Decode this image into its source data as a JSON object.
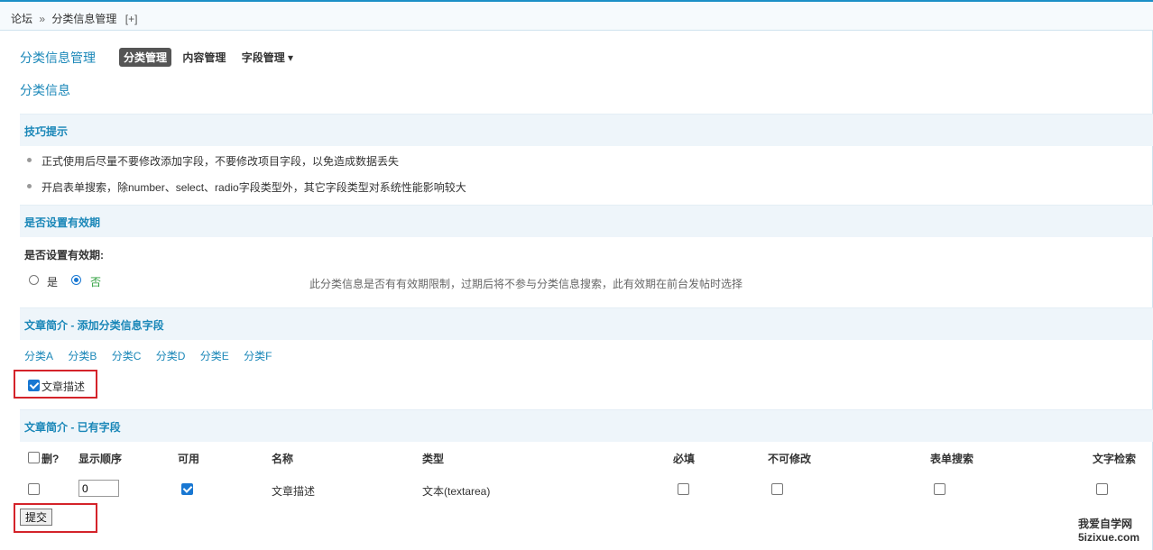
{
  "breadcrumb": {
    "root": "论坛",
    "separator": "»",
    "current": "分类信息管理",
    "add": "[+]"
  },
  "header": {
    "title": "分类信息管理",
    "tabs": [
      {
        "label": "分类管理"
      },
      {
        "label": "内容管理"
      },
      {
        "label": "字段管理 ▾"
      }
    ]
  },
  "subtitle": "分类信息",
  "tips": {
    "title": "技巧提示",
    "items": [
      "正式使用后尽量不要修改添加字段，不要修改项目字段，以免造成数据丢失",
      "开启表单搜索，除number、select、radio字段类型外，其它字段类型对系统性能影响较大"
    ]
  },
  "expiry": {
    "section_title": "是否设置有效期",
    "label": "是否设置有效期:",
    "options": [
      {
        "label": "是",
        "checked": false
      },
      {
        "label": "否",
        "checked": true
      }
    ],
    "hint": "此分类信息是否有有效期限制，过期后将不参与分类信息搜索，此有效期在前台发帖时选择"
  },
  "add_fields": {
    "section_title": "文章简介 - 添加分类信息字段",
    "categories": [
      "分类A",
      "分类B",
      "分类C",
      "分类D",
      "分类E",
      "分类F"
    ],
    "field_option": {
      "label": "文章描述",
      "checked": true
    }
  },
  "existing_fields": {
    "section_title": "文章简介 - 已有字段",
    "columns": {
      "delete": "删?",
      "order": "显示顺序",
      "enabled": "可用",
      "name": "名称",
      "type": "类型",
      "required": "必填",
      "readonly": "不可修改",
      "form_search": "表单搜索",
      "text_search": "文字检索"
    },
    "rows": [
      {
        "delete": false,
        "order": "0",
        "enabled": true,
        "name": "文章描述",
        "type": "文本(textarea)",
        "required": false,
        "readonly": false,
        "form_search": false,
        "text_search": false
      }
    ]
  },
  "submit_label": "提交",
  "watermark": {
    "line1": "我爱自学网",
    "line2": "5izixue.com"
  },
  "colors": {
    "accent": "#1a87b8",
    "highlight_box": "#d4232a",
    "band_bg": "#eef5fa",
    "checkbox": "#1877d2"
  }
}
